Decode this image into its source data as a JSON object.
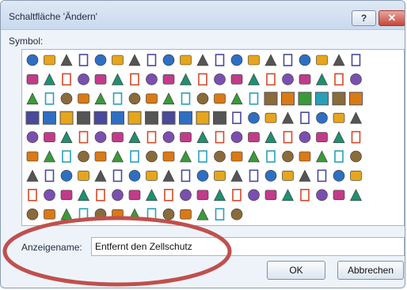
{
  "dialog": {
    "title": "Schaltfläche 'Ändern'",
    "help_label": "?",
    "close_label": "✕"
  },
  "symbol_label": "Symbol:",
  "icons": [
    [
      "organization-chart",
      "stop-error",
      "info",
      "help",
      "warning",
      "exclamation",
      "diamond",
      "shield",
      "save",
      "print-preview",
      "window",
      "folder",
      "document",
      "new-folder",
      "folder-open",
      "printer",
      "image",
      "design",
      "home",
      "smiley"
    ],
    [
      "arrows-back-forward",
      "arrows-forward",
      "arrow-left",
      "arrow-up",
      "arrow-down",
      "arrow-right",
      "circle-back",
      "pin",
      "lock",
      "key",
      "pencil",
      "paint",
      "window-blue",
      "magnifier",
      "filter",
      "funnel",
      "book",
      "sitemap",
      "glasses",
      "cut"
    ],
    [
      "person",
      "dollar",
      "clock",
      "lightbulb",
      "hand",
      "smile-face",
      "sad-face",
      "calendar",
      "phone",
      "disk",
      "ball-8",
      "quote",
      "eye",
      "cloud",
      "swatch-blue",
      "swatch-white",
      "swatch-darkgray",
      "swatch-gray",
      "swatch-lightgray",
      "swatch-tan"
    ],
    [
      "swatch-teal",
      "swatch-azure",
      "swatch-steel",
      "swatch-olive",
      "swatch-purple",
      "swatch-violet",
      "swatch-black",
      "swatch-charcoal",
      "swatch-white2",
      "swatch-darkcyan",
      "swatch-darkgreen",
      "swatch-checker",
      "circle-arrow",
      "drop",
      "bar-chart",
      "arrow-chart",
      "shapes",
      "colors",
      "bullets",
      "zoom"
    ],
    [
      "pie-chart",
      "donut",
      "cylinder",
      "3d-shapes",
      "package",
      "clipboard",
      "align",
      "chart-box",
      "globe",
      "shape-fill",
      "sparkle",
      "letter-A",
      "letter-A-box",
      "delete-x",
      "checkmark",
      "check-edit",
      "refresh",
      "bracket",
      "pi",
      "paint-can"
    ],
    [
      "binoculars",
      "check-pencil",
      "list",
      "play",
      "anchor",
      "chart-star",
      "lasso",
      "picture",
      "document-alt",
      "form",
      "eraser",
      "flag",
      "heart",
      "person-badge",
      "envelope",
      "form-window",
      "columns",
      "edit",
      "ball-orange",
      "sun"
    ],
    [
      "ball-green",
      "globe-stand",
      "home-arrow",
      "puzzle",
      "sticky-note",
      "calendar-blank",
      "speech",
      "cube",
      "palette",
      "handshake",
      "window-small",
      "grid",
      "table",
      "hierarchy",
      "grid-small",
      "cursor",
      "spelling",
      "abc",
      "move",
      "cross-box"
    ],
    [
      "hourglass",
      "underline",
      "justify",
      "edit-tool",
      "scissors",
      "colored-balls",
      "photo",
      "column-table",
      "superscript",
      "table-merge",
      "split-table",
      "align-grid",
      "frame",
      "insert-table",
      "table-cols",
      "table-gray",
      "table-list",
      "table-rows",
      "table-split",
      "grid-arrow"
    ],
    [
      "dots-grid",
      "dots-fine",
      "grid-hash",
      "grid-wide",
      "undo",
      "redo",
      "flower",
      "diamond-purple",
      "arrow-down-blue",
      "arrow-up-blue",
      "equation",
      "cloud-shape",
      "text-box"
    ]
  ],
  "name_label": "Anzeigename:",
  "name_value": "Entfernt den Zellschutz",
  "ok_label": "OK",
  "cancel_label": "Abbrechen",
  "colors": {
    "accent": "#1e3f7a",
    "annotation_circle": "#c0504d"
  }
}
